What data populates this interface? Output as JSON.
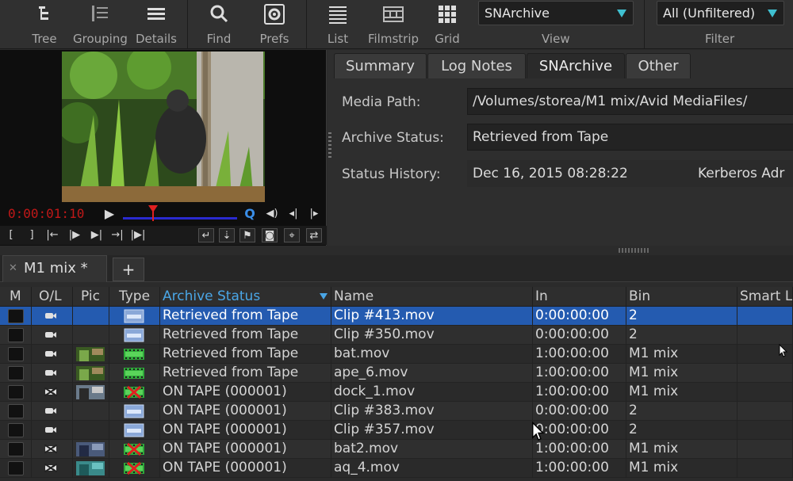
{
  "toolbar": {
    "buttons": [
      {
        "label": "Tree",
        "icon": "tree-icon"
      },
      {
        "label": "Grouping",
        "icon": "grouping-icon"
      },
      {
        "label": "Details",
        "icon": "details-icon"
      },
      {
        "label": "Find",
        "icon": "search-icon"
      },
      {
        "label": "Prefs",
        "icon": "gear-icon"
      },
      {
        "label": "List",
        "icon": "list-icon"
      },
      {
        "label": "Filmstrip",
        "icon": "filmstrip-icon"
      },
      {
        "label": "Grid",
        "icon": "grid-icon"
      }
    ],
    "view": {
      "label": "View",
      "value": "SNArchive"
    },
    "filter": {
      "label": "Filter",
      "value": "All (Unfiltered)"
    },
    "accent": "#3fc0d0"
  },
  "player": {
    "timecode": "0:00:01:10",
    "timecode_color": "#c01818",
    "quality_label": "Q"
  },
  "info": {
    "tabs": [
      "Summary",
      "Log Notes",
      "SNArchive",
      "Other"
    ],
    "active_tab": "SNArchive",
    "fields": {
      "media_path_label": "Media Path:",
      "media_path_value": "/Volumes/storea/M1 mix/Avid MediaFiles/",
      "archive_status_label": "Archive Status:",
      "archive_status_value": "Retrieved from Tape",
      "status_history_label": "Status History:",
      "status_history_date": "Dec 16, 2015 08:28:22",
      "status_history_user": "Kerberos Adr"
    }
  },
  "bin": {
    "tab_label": "M1 mix *",
    "add_tab_label": "+"
  },
  "table": {
    "columns": [
      "M",
      "O/L",
      "Pic",
      "Type",
      "Archive Status",
      "Name",
      "In",
      "Bin",
      "Smart L"
    ],
    "sorted_column": "Archive Status",
    "selection_color": "#245bb0",
    "rows": [
      {
        "status": "Retrieved from Tape",
        "name": "Clip #413.mov",
        "in": "0:00:00:00",
        "bin": "2",
        "online": true,
        "pic": "",
        "type": "mxf"
      },
      {
        "status": "Retrieved from Tape",
        "name": "Clip #350.mov",
        "in": "0:00:00:00",
        "bin": "2",
        "online": true,
        "pic": "",
        "type": "mxf"
      },
      {
        "status": "Retrieved from Tape",
        "name": "bat.mov",
        "in": "1:00:00:00",
        "bin": "M1 mix",
        "online": true,
        "pic": "forest",
        "type": "film"
      },
      {
        "status": "Retrieved from Tape",
        "name": "ape_6.mov",
        "in": "1:00:00:00",
        "bin": "M1 mix",
        "online": true,
        "pic": "forest",
        "type": "film"
      },
      {
        "status": "ON TAPE (000001)",
        "name": "dock_1.mov",
        "in": "1:00:00:00",
        "bin": "M1 mix",
        "online": false,
        "pic": "dock",
        "type": "film-offline"
      },
      {
        "status": "ON TAPE (000001)",
        "name": "Clip #383.mov",
        "in": "0:00:00:00",
        "bin": "2",
        "online": true,
        "pic": "",
        "type": "mxf"
      },
      {
        "status": "ON TAPE (000001)",
        "name": "Clip #357.mov",
        "in": "0:00:00:00",
        "bin": "2",
        "online": true,
        "pic": "",
        "type": "mxf"
      },
      {
        "status": "ON TAPE (000001)",
        "name": "bat2.mov",
        "in": "1:00:00:00",
        "bin": "M1 mix",
        "online": false,
        "pic": "night",
        "type": "film-offline"
      },
      {
        "status": "ON TAPE (000001)",
        "name": "aq_4.mov",
        "in": "1:00:00:00",
        "bin": "M1 mix",
        "online": false,
        "pic": "water",
        "type": "film-offline"
      }
    ]
  }
}
